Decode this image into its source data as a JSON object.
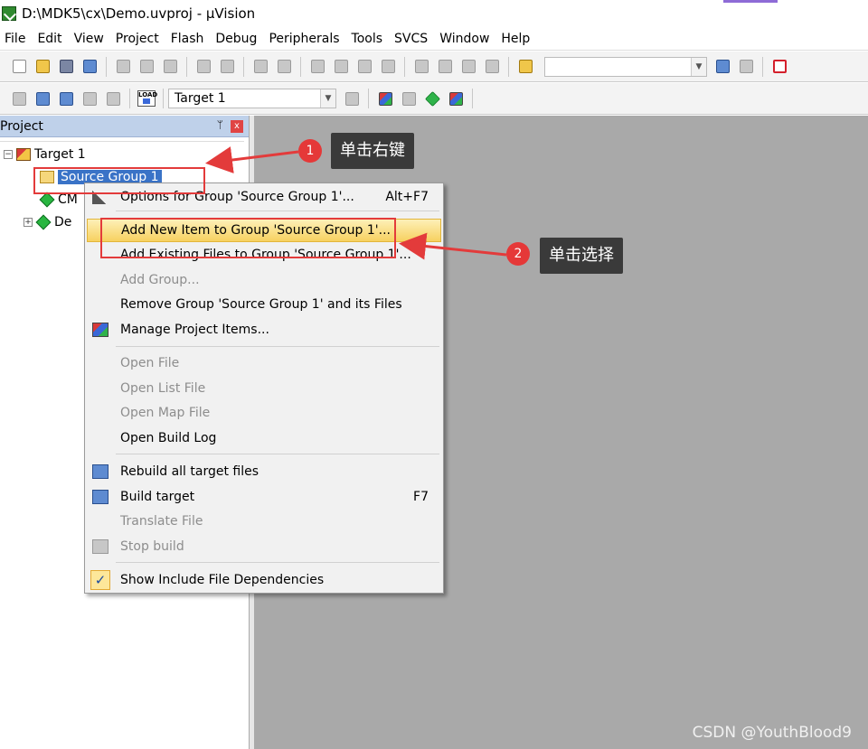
{
  "window": {
    "title": "D:\\MDK5\\cx\\Demo.uvproj - µVision"
  },
  "menu": [
    "File",
    "Edit",
    "View",
    "Project",
    "Flash",
    "Debug",
    "Peripherals",
    "Tools",
    "SVCS",
    "Window",
    "Help"
  ],
  "toolbar": {
    "target_combo_value": "Target 1",
    "load_label": "LOAD"
  },
  "project_panel": {
    "title": "Project",
    "pin": "ᛘ",
    "close": "x",
    "tree": {
      "target": "Target 1",
      "group": "Source Group 1",
      "child_cm": "CM",
      "child_de": "De"
    }
  },
  "context_menu": {
    "items": [
      {
        "label": "Options for Group 'Source Group 1'...",
        "shortcut": "Alt+F7",
        "enabled": true,
        "icon": "wand-icon"
      },
      {
        "label": "Add New  Item to Group 'Source Group 1'...",
        "shortcut": "",
        "enabled": true,
        "highlighted": true
      },
      {
        "label": "Add Existing Files to Group 'Source Group 1'...",
        "shortcut": "",
        "enabled": true
      },
      {
        "label": "Add Group...",
        "shortcut": "",
        "enabled": false
      },
      {
        "label": "Remove Group 'Source Group 1' and its Files",
        "shortcut": "",
        "enabled": true
      },
      {
        "label": "Manage Project Items...",
        "shortcut": "",
        "enabled": true,
        "icon": "manage-items-icon"
      },
      {
        "label": "Open File",
        "shortcut": "",
        "enabled": false
      },
      {
        "label": "Open List File",
        "shortcut": "",
        "enabled": false
      },
      {
        "label": "Open Map File",
        "shortcut": "",
        "enabled": false
      },
      {
        "label": "Open Build Log",
        "shortcut": "",
        "enabled": true
      },
      {
        "label": "Rebuild all target files",
        "shortcut": "",
        "enabled": true,
        "icon": "rebuild-icon"
      },
      {
        "label": "Build target",
        "shortcut": "F7",
        "enabled": true,
        "icon": "build-icon"
      },
      {
        "label": "Translate File",
        "shortcut": "",
        "enabled": false
      },
      {
        "label": "Stop build",
        "shortcut": "",
        "enabled": false,
        "icon": "stop-build-icon"
      },
      {
        "label": "Show Include File Dependencies",
        "shortcut": "",
        "enabled": true,
        "checked": true
      }
    ],
    "check_mark": "✓"
  },
  "annotations": {
    "step1_number": "1",
    "step1_text": "单击右键",
    "step2_number": "2",
    "step2_text": "单击选择"
  },
  "watermark": "CSDN @YouthBlood9",
  "colors": {
    "annotation_red": "#e33b3b",
    "callout_bg": "#3a3a3a",
    "workspace_gray": "#a9a9a9",
    "selection_blue": "#3a73c7"
  }
}
